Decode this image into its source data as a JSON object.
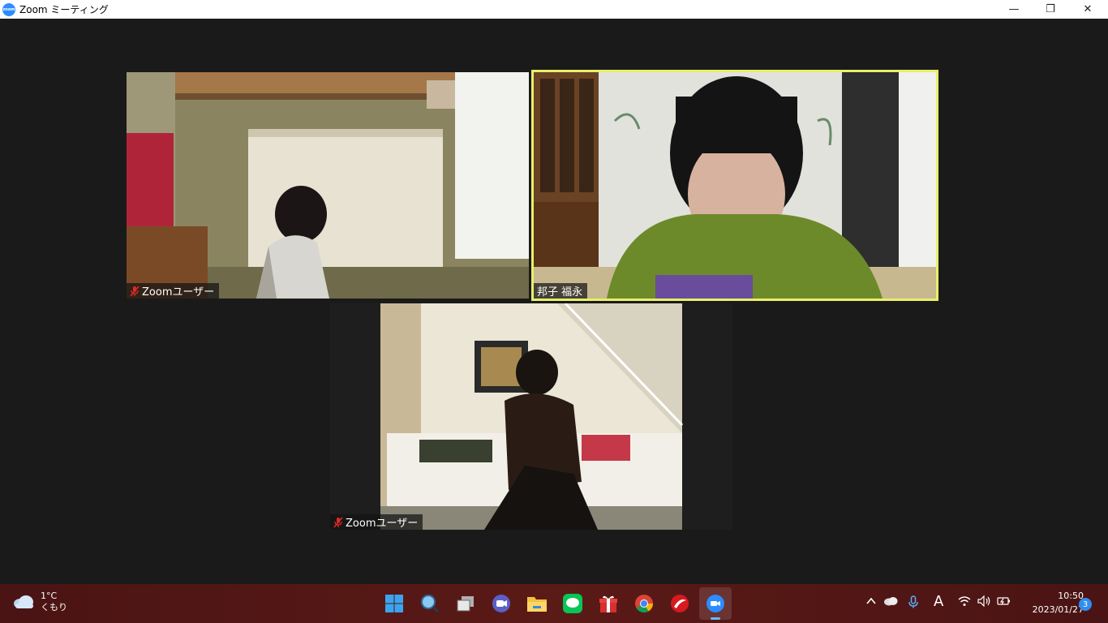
{
  "window": {
    "title": "Zoom ミーティング",
    "app_icon_text": "zoom",
    "minimize_glyph": "—",
    "maximize_glyph": "❐",
    "close_glyph": "✕"
  },
  "participants": [
    {
      "name": "Zoomユーザー",
      "muted": true
    },
    {
      "name": "邦子 福永",
      "muted": false,
      "active_speaker": true
    },
    {
      "name": "Zoomユーザー",
      "muted": true
    }
  ],
  "taskbar": {
    "weather": {
      "temp": "1°C",
      "desc": "くもり"
    },
    "pinned": [
      "start-icon",
      "search-icon",
      "task-view-icon",
      "teams-chat-icon",
      "file-explorer-icon",
      "line-icon",
      "gift-icon",
      "chrome-icon",
      "trend-micro-icon",
      "zoom-icon"
    ],
    "tray": {
      "ime": "A"
    },
    "clock": {
      "time": "10:50",
      "date": "2023/01/27"
    },
    "notifications": "3"
  },
  "colors": {
    "active_speaker_border": "#e8ef6a",
    "zoom_blue": "#2d8cff",
    "taskbar": "#4a1414"
  }
}
